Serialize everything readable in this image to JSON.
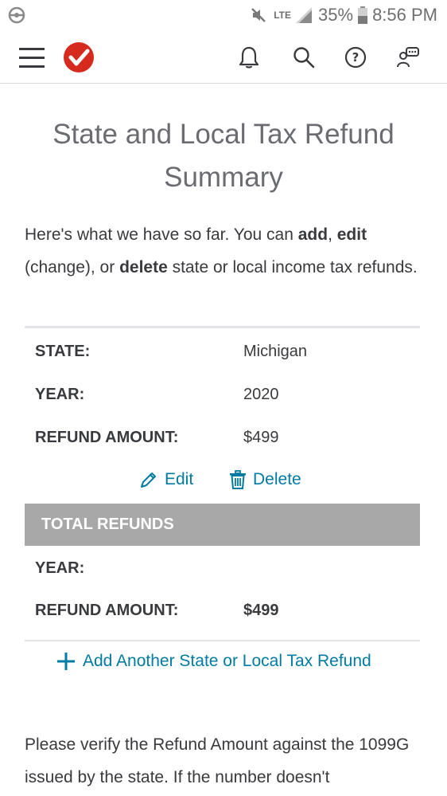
{
  "status_bar": {
    "network": "LTE",
    "battery": "35%",
    "time": "8:56 PM"
  },
  "header": {
    "icons": [
      "menu-icon",
      "turbotax-checkmark-logo",
      "bell-icon",
      "search-icon",
      "help-icon",
      "chat-icon"
    ]
  },
  "page": {
    "title_line1": "State and Local Tax Refund",
    "title_line2": "Summary",
    "intro": {
      "part1": "Here's what we have so far. You can ",
      "add": "add",
      "comma": ", ",
      "edit": "edit",
      "part2": " (change), or ",
      "delete": "delete",
      "part3": " state or local income tax refunds."
    }
  },
  "refund_entry": {
    "state_label": "STATE:",
    "state_value": "Michigan",
    "year_label": "YEAR:",
    "year_value": "2020",
    "amount_label": "REFUND AMOUNT:",
    "amount_value": "$499",
    "edit_label": "Edit",
    "delete_label": "Delete"
  },
  "totals": {
    "header": "TOTAL REFUNDS",
    "year_label": "YEAR:",
    "amount_label": "REFUND AMOUNT:",
    "amount_value": "$499"
  },
  "add_link": "Add Another State or Local Tax Refund",
  "verify_text": "Please verify the Refund Amount against the 1099G issued by the state. If the number doesn't",
  "colors": {
    "link": "#007ba3",
    "logo_red": "#d52b1e",
    "total_bar": "#a8a8a8",
    "divider": "#e3e5e8"
  }
}
